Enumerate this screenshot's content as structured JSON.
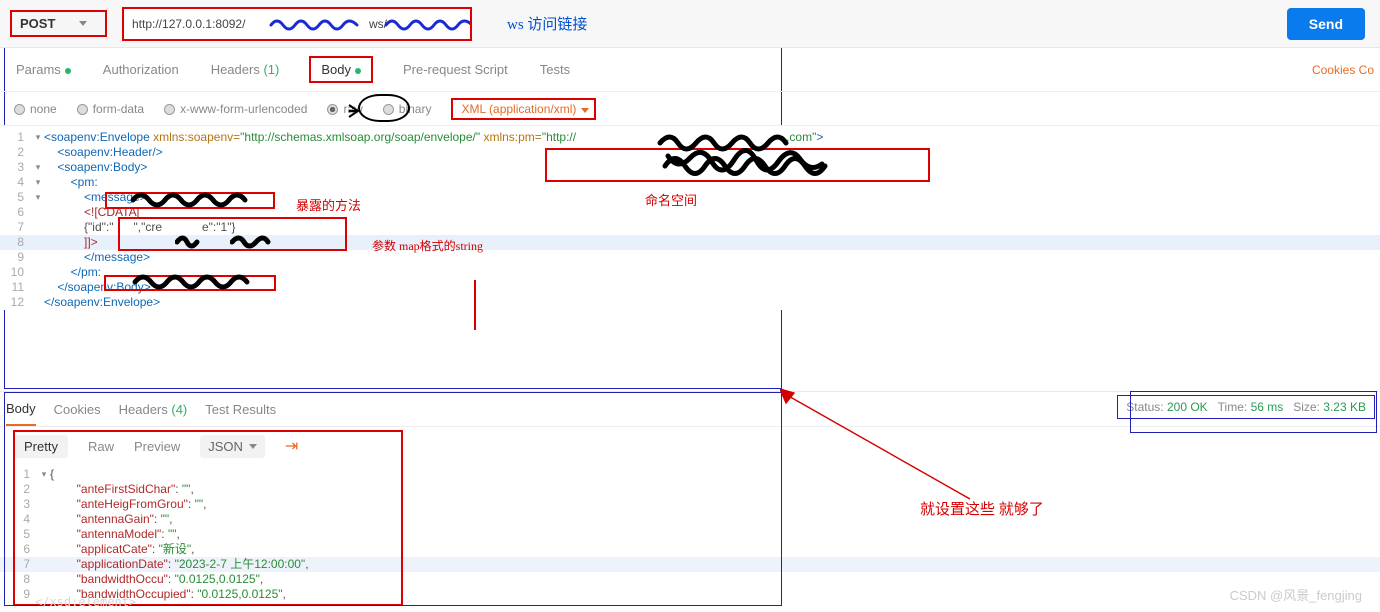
{
  "method": "POST",
  "url_visible_prefix": "http://127.0.0.1:8092/",
  "url_mid": "ws/",
  "ws_label": "ws    访问链接",
  "send_btn": "Send",
  "tabs": {
    "params": "Params",
    "auth": "Authorization",
    "headers": "Headers",
    "hcount": "(1)",
    "body": "Body",
    "prereq": "Pre-request Script",
    "tests": "Tests",
    "cookies": "Cookies  Co"
  },
  "bodytype": {
    "none": "none",
    "form": "form-data",
    "urlenc": "x-www-form-urlencoded",
    "raw": "raw",
    "binary": "binary",
    "content": "XML (application/xml)"
  },
  "req_lines": {
    "l1a": "<soapenv:Envelope",
    "l1b": " xmlns:soapenv=",
    "l1c": "\"http://schemas.xmlsoap.org/soap/envelope/\"",
    "l1d": " xmlns:pm=",
    "l1e": "\"http://",
    "l1f": ".com\"",
    "l1g": ">",
    "l2": "    <soapenv:Header/>",
    "l3": "    <soapenv:Body>",
    "l4": "        <pm:",
    "l5": "            <message>",
    "l6": "            <![CDATA[",
    "l7a": "            {\"id\":\"",
    "l7b": "\",\"cre",
    "l7c": "e\":\"1\"}",
    "l8": "            ]]>",
    "l9": "            </message>",
    "l10": "        </pm:",
    "l11": "    </soapenv:Body>",
    "l12": "</soapenv:Envelope>"
  },
  "anno": {
    "method": "暴露的方法",
    "param": "参数    map格式的string",
    "ns": "命名空间",
    "enough": "就设置这些  就够了"
  },
  "resptabs": {
    "body": "Body",
    "cookies": "Cookies",
    "headers": "Headers",
    "hcnt": "(4)",
    "tests": "Test Results"
  },
  "status": {
    "s": "Status:",
    "sv": "200 OK",
    "t": "Time:",
    "tv": "56 ms",
    "z": "Size:",
    "zv": "3.23 KB"
  },
  "fmt": {
    "pretty": "Pretty",
    "raw": "Raw",
    "preview": "Preview",
    "json": "JSON"
  },
  "res": {
    "l1": "{",
    "k2": "\"anteFirstSidChar\"",
    "v2": "\"\"",
    "k3": "\"anteHeigFromGrou\"",
    "v3": "\"\"",
    "k4": "\"antennaGain\"",
    "v4": "\"\"",
    "k5": "\"antennaModel\"",
    "v5": "\"\"",
    "k6": "\"applicatCate\"",
    "v6": "\"新设\"",
    "k7": "\"applicationDate\"",
    "v7": "\"2023-2-7 上午12:00:00\"",
    "k8": "\"bandwidthOccu\"",
    "v8": "\"0.0125,0.0125\"",
    "k9": "\"bandwidthOccupied\"",
    "v9": "\"0.0125,0.0125\""
  },
  "watermark": "CSDN @风景_fengjing",
  "ghost": "</xsd:element>"
}
